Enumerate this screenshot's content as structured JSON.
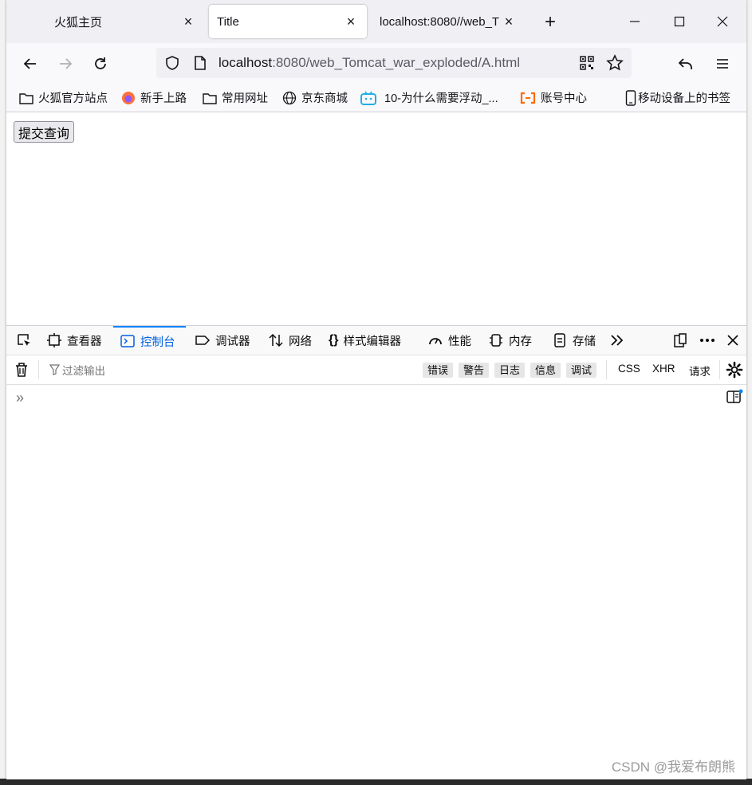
{
  "tabs": [
    {
      "title": "火狐主页",
      "close": "×"
    },
    {
      "title": "Title",
      "close": "×"
    },
    {
      "title": "localhost:8080//web_T",
      "close": "×"
    }
  ],
  "window_controls": {
    "new_tab": "+",
    "minimize": "—",
    "maximize": "☐",
    "close": "✕"
  },
  "navbar": {
    "url_host": "localhost",
    "url_rest": ":8080/web_Tomcat_war_exploded/A.html"
  },
  "bookmarks": [
    {
      "label": "火狐官方站点",
      "icon": "folder-icon"
    },
    {
      "label": "新手上路",
      "icon": "firefox-icon"
    },
    {
      "label": "常用网址",
      "icon": "folder-icon"
    },
    {
      "label": "京东商城",
      "icon": "globe-icon"
    },
    {
      "label": "10-为什么需要浮动_...",
      "icon": "bilibili-icon"
    },
    {
      "label": "账号中心",
      "icon": "aliyun-icon"
    },
    {
      "label": "移动设备上的书签",
      "icon": "mobile-icon"
    }
  ],
  "page": {
    "submit_button": "提交查询"
  },
  "devtools": {
    "tabs": [
      "查看器",
      "控制台",
      "调试器",
      "网络",
      "样式编辑器",
      "性能",
      "内存",
      "存储"
    ],
    "active_tab": "控制台",
    "filter_placeholder": "过滤输出",
    "levels": [
      "错误",
      "警告",
      "日志",
      "信息",
      "调试"
    ],
    "filters": [
      "CSS",
      "XHR",
      "请求"
    ],
    "prompt": "»"
  },
  "watermark": "CSDN @我爱布朗熊",
  "colors": {
    "accent": "#0060df",
    "active_tab_border": "#0a84ff"
  }
}
